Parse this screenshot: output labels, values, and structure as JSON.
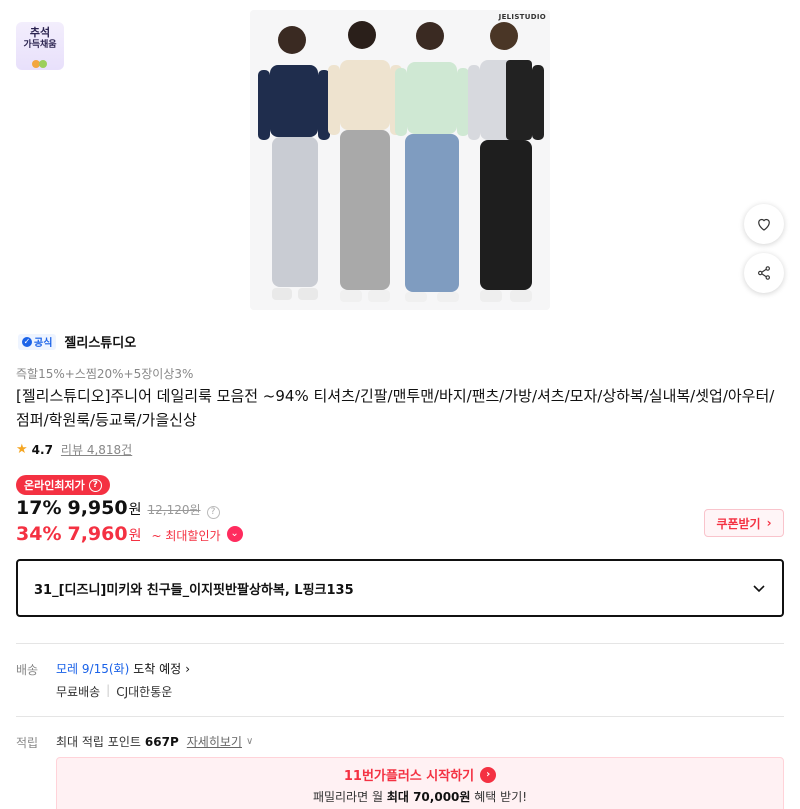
{
  "badge": {
    "line1": "추석",
    "line2": "가득채움"
  },
  "product_image": {
    "brand": "JELISTUDIO"
  },
  "icons": {
    "wishlist": "heart-icon",
    "share": "share-icon"
  },
  "seller": {
    "official_label": "공식",
    "name": "젤리스튜디오"
  },
  "discount_info": "즉할15%+스찜20%+5장이상3%",
  "title": "[젤리스튜디오]주니어 데일리룩 모음전 ~94% 티셔츠/긴팔/맨투맨/바지/팬츠/가방/셔츠/모자/상하복/실내복/셋업/아우터/점퍼/학원룩/등교룩/가을신상",
  "rating": {
    "score": "4.7",
    "review_label": "리뷰 4,818건"
  },
  "lowest_badge": "온라인최저가",
  "price": {
    "rate": "17%",
    "amount": "9,950",
    "won": "원",
    "original": "12,120원"
  },
  "max_price": {
    "rate": "34%",
    "amount": "7,960",
    "won": "원",
    "label": "~ 최대할인가"
  },
  "coupon_button": "쿠폰받기",
  "option": {
    "selected": "31_[디즈니]미키와 친구들_이지핏반팔상하복, L핑크135"
  },
  "delivery": {
    "label": "배송",
    "date": "모레 9/15(화)",
    "date_suffix": "도착 예정",
    "fee": "무료배송",
    "carrier": "CJ대한통운"
  },
  "points": {
    "label": "적립",
    "text": "최대 적립 포인트",
    "value": "667P",
    "more": "자세히보기"
  },
  "promo": {
    "title": "11번가플러스 시작하기",
    "line2_pre": "패밀리라면 월",
    "line2_bold": "최대 70,000원",
    "line2_post": "혜택 받기!"
  },
  "colors": {
    "accent_red": "#f43142",
    "link_blue": "#1a62e8"
  }
}
